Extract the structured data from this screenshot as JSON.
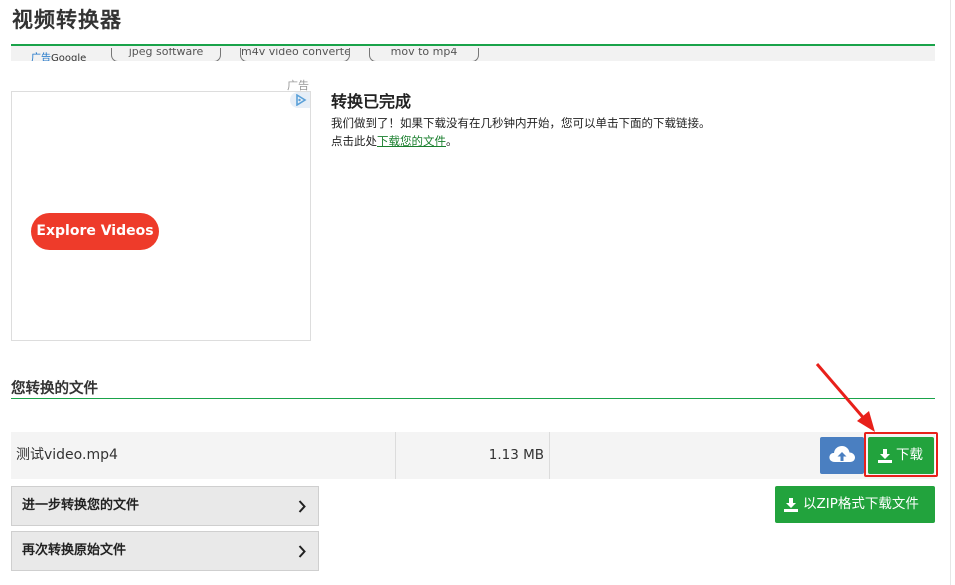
{
  "page": {
    "title": "视频转换器"
  },
  "ad_bar": {
    "label_ad": "广告",
    "label_google": "Google",
    "chips": [
      "jpeg software",
      "m4v video converte",
      "mov to mp4"
    ]
  },
  "ad": {
    "tag": "广告",
    "button_label": "Explore Videos"
  },
  "completion": {
    "title": "转换已完成",
    "line1": "我们做到了！如果下载没有在几秒钟内开始，您可以单击下面的下载链接。",
    "line2_prefix": "点击此处",
    "line2_link": "下载您的文件",
    "line2_suffix": "。"
  },
  "files_section": {
    "heading": "您转换的文件",
    "files": [
      {
        "name": "测试video.mp4",
        "size": "1.13 MB",
        "download_label": "下载"
      }
    ],
    "zip_label": "以ZIP格式下载文件"
  },
  "actions": {
    "convert_further": "进一步转换您的文件",
    "convert_again": "再次转换原始文件"
  },
  "colors": {
    "accent_green": "#22a33d",
    "cloud_blue": "#4a7fc1",
    "highlight_red": "#e8201a",
    "ad_button_red": "#ee3b2a"
  },
  "icons": [
    "ad-choices-icon",
    "cloud-upload-icon",
    "download-icon",
    "chevron-right-icon"
  ]
}
